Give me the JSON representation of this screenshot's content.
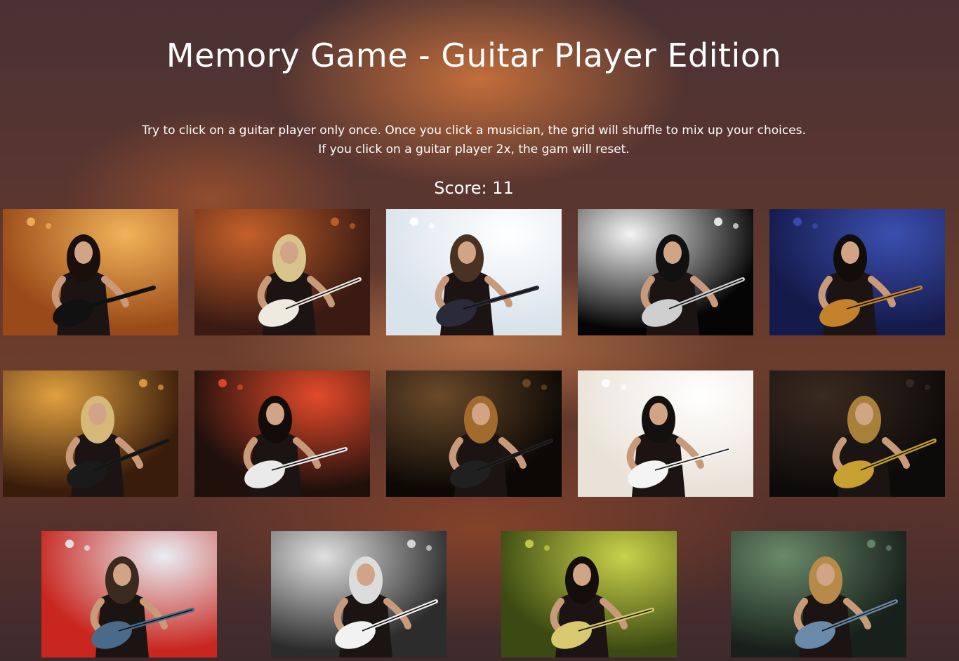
{
  "header": {
    "title": "Memory Game - Guitar Player Edition"
  },
  "instructions": {
    "line1": "Try to click on a guitar player only once. Once you click a musician, the grid will shuffle to mix up your choices.",
    "line2": "If you click on a guitar player 2x, the gam will reset."
  },
  "score": {
    "label": "Score: 11"
  },
  "colors": {
    "text": "#ffffff",
    "background_dark": "#4a3133",
    "background_glow": "#d6783c"
  },
  "cards": [
    {
      "name": "guitarist-card-1",
      "bg": "#9a4a18",
      "light": "#f1b35a",
      "guitar": "#111111",
      "hair": "#1a0f0a"
    },
    {
      "name": "guitarist-card-2",
      "bg": "#3a1a12",
      "light": "#c4602a",
      "guitar": "#eeeae0",
      "hair": "#d8c48a"
    },
    {
      "name": "guitarist-card-3",
      "bg": "#d9e3ec",
      "light": "#ffffff",
      "guitar": "#2a2a38",
      "hair": "#4a3222"
    },
    {
      "name": "guitarist-card-4",
      "bg": "#050505",
      "light": "#f4f4f4",
      "guitar": "#cfcfcf",
      "hair": "#111111"
    },
    {
      "name": "guitarist-card-5",
      "bg": "#141a4a",
      "light": "#3b4fb0",
      "guitar": "#c6822a",
      "hair": "#120d0a"
    },
    {
      "name": "guitarist-card-6",
      "bg": "#3a1c0a",
      "light": "#e0a040",
      "guitar": "#1a1a1a",
      "hair": "#d6b878"
    },
    {
      "name": "guitarist-card-7",
      "bg": "#1f100c",
      "light": "#e34a2a",
      "guitar": "#eaeaea",
      "hair": "#120c0a"
    },
    {
      "name": "guitarist-card-8",
      "bg": "#0b0805",
      "light": "#6a4a2a",
      "guitar": "#202020",
      "hair": "#a06b2c"
    },
    {
      "name": "guitarist-card-9",
      "bg": "#e9e2d8",
      "light": "#ffffff",
      "guitar": "#f4f4f4",
      "hair": "#141010"
    },
    {
      "name": "guitarist-card-10",
      "bg": "#0d0b0a",
      "light": "#3a2a20",
      "guitar": "#c8a030",
      "hair": "#a8803a"
    },
    {
      "name": "guitarist-card-11",
      "bg": "#c8261e",
      "light": "#e8eef4",
      "guitar": "#4a6a8a",
      "hair": "#3a2a20"
    },
    {
      "name": "guitarist-card-12",
      "bg": "#2c2c2c",
      "light": "#e0e0e0",
      "guitar": "#f2f2f2",
      "hair": "#dcdcdc"
    },
    {
      "name": "guitarist-card-13",
      "bg": "#3b4a12",
      "light": "#c9d24a",
      "guitar": "#d8c870",
      "hair": "#140e0a"
    },
    {
      "name": "guitarist-card-14",
      "bg": "#17201a",
      "light": "#6a8a6a",
      "guitar": "#6a8aaa",
      "hair": "#b88a4a"
    }
  ]
}
